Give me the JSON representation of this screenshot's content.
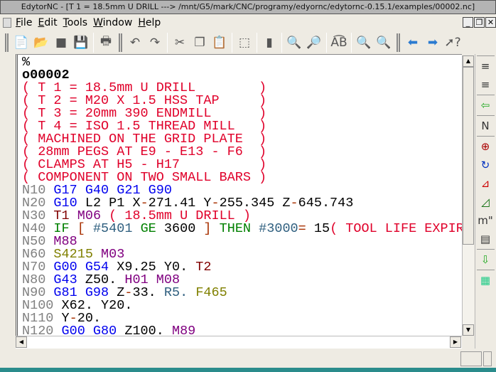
{
  "window": {
    "title": "EdytorNC - [T 1 = 18.5mm U DRILL ---> /mnt/G5/mark/CNC/programy/edyornc/edytornc-0.15.1/examples/00002.nc]"
  },
  "menu": [
    {
      "u": "F",
      "rest": "ile"
    },
    {
      "u": "E",
      "rest": "dit"
    },
    {
      "u": "T",
      "rest": "ools"
    },
    {
      "u": "W",
      "rest": "indow"
    },
    {
      "u": "H",
      "rest": "elp"
    }
  ],
  "toolbar": [
    "new-file-icon",
    "open-file-icon",
    "close-file-icon",
    "save-icon",
    "|",
    "print-icon",
    "|g",
    "undo-icon",
    "redo-icon",
    "|",
    "cut-icon",
    "copy-icon",
    "paste-icon",
    "|",
    "select-all-icon",
    "|",
    "document-icon",
    "|",
    "find-icon",
    "find-next-icon",
    "|",
    "replace-icon",
    "|",
    "zoom-in-icon",
    "zoom-out-icon",
    "|g",
    "back-icon",
    "forward-icon",
    "whats-this-icon"
  ],
  "right_toolbar": [
    "insert-spaces-icon",
    "remove-spaces-icon",
    "|",
    "import-icon",
    "|",
    "renumber-icon",
    "|",
    "bolt-circle-icon",
    "feed-speed-icon",
    "triangle-solver-icon",
    "trig-icon",
    "convert-inch-mm-icon",
    "convert-table-icon",
    "|",
    "insert-file-icon",
    "|",
    "calculator-icon"
  ],
  "colors": {
    "num": "#808080",
    "g": "#0000ee",
    "c": "#e0002a",
    "m": "#800080",
    "t": "#800000",
    "k": "#008000",
    "v": "#2f5f7f",
    "b": "#a83000",
    "o": "#808000",
    "x": "#000000"
  },
  "code": [
    [
      [
        "%",
        "x"
      ]
    ],
    [
      [
        "o00002",
        "x"
      ]
    ],
    [
      [
        "( T 1 = 18.5mm U DRILL        )",
        "c"
      ]
    ],
    [
      [
        "( T 2 = M20 X 1.5 HSS TAP     )",
        "c"
      ]
    ],
    [
      [
        "( T 3 = 20mm 390 ENDMILL      )",
        "c"
      ]
    ],
    [
      [
        "( T 4 = ISO 1.5 THREAD MILL   )",
        "c"
      ]
    ],
    [
      [
        "( MACHINED ON THE GRID PLATE  )",
        "c"
      ]
    ],
    [
      [
        "( 28mm PEGS AT E9 - E13 - F6  )",
        "c"
      ]
    ],
    [
      [
        "( CLAMPS AT H5 - H17          )",
        "c"
      ]
    ],
    [
      [
        "( COMPONENT ON TWO SMALL BARS )",
        "c"
      ]
    ],
    [
      [
        "N10 ",
        "num"
      ],
      [
        "G17 G40 G21 G90",
        "g"
      ]
    ],
    [
      [
        "N20 ",
        "num"
      ],
      [
        "G10",
        "g"
      ],
      [
        " L2 P1 X",
        "x"
      ],
      [
        "-",
        "b"
      ],
      [
        "271.41 Y",
        "x"
      ],
      [
        "-",
        "b"
      ],
      [
        "255.345 Z",
        "x"
      ],
      [
        "-",
        "b"
      ],
      [
        "645.743",
        "x"
      ]
    ],
    [
      [
        "N30 ",
        "num"
      ],
      [
        "T1 ",
        "t"
      ],
      [
        "M06 ",
        "m"
      ],
      [
        "( 18.5mm U DRILL )",
        "c"
      ]
    ],
    [
      [
        "N40 ",
        "num"
      ],
      [
        "IF ",
        "k"
      ],
      [
        "[ ",
        "b"
      ],
      [
        "#5401 ",
        "v"
      ],
      [
        "GE ",
        "k"
      ],
      [
        "3600 ",
        "x"
      ],
      [
        "] ",
        "b"
      ],
      [
        "THEN ",
        "k"
      ],
      [
        "#3000",
        "v"
      ],
      [
        "=",
        "b"
      ],
      [
        " 15",
        "x"
      ],
      [
        "( TOOL LIFE EXPIRED",
        "c"
      ]
    ],
    [
      [
        "N50 ",
        "num"
      ],
      [
        "M88",
        "m"
      ]
    ],
    [
      [
        "N60 ",
        "num"
      ],
      [
        "S4215 ",
        "o"
      ],
      [
        "M03",
        "m"
      ]
    ],
    [
      [
        "N70 ",
        "num"
      ],
      [
        "G00 G54 ",
        "g"
      ],
      [
        "X9.25 Y0. ",
        "x"
      ],
      [
        "T2",
        "t"
      ]
    ],
    [
      [
        "N80 ",
        "num"
      ],
      [
        "G43 ",
        "g"
      ],
      [
        "Z50. ",
        "x"
      ],
      [
        "H01 M08",
        "m"
      ]
    ],
    [
      [
        "N90 ",
        "num"
      ],
      [
        "G81 G98 ",
        "g"
      ],
      [
        "Z",
        "x"
      ],
      [
        "-",
        "b"
      ],
      [
        "33. ",
        "x"
      ],
      [
        "R5. ",
        "v"
      ],
      [
        "F465",
        "o"
      ]
    ],
    [
      [
        "N100 ",
        "num"
      ],
      [
        "X62. Y20.",
        "x"
      ]
    ],
    [
      [
        "N110 ",
        "num"
      ],
      [
        "Y",
        "x"
      ],
      [
        "-",
        "b"
      ],
      [
        "20.",
        "x"
      ]
    ],
    [
      [
        "N120 ",
        "num"
      ],
      [
        "G00 G80 ",
        "g"
      ],
      [
        "Z100. ",
        "x"
      ],
      [
        "M89",
        "m"
      ]
    ]
  ]
}
